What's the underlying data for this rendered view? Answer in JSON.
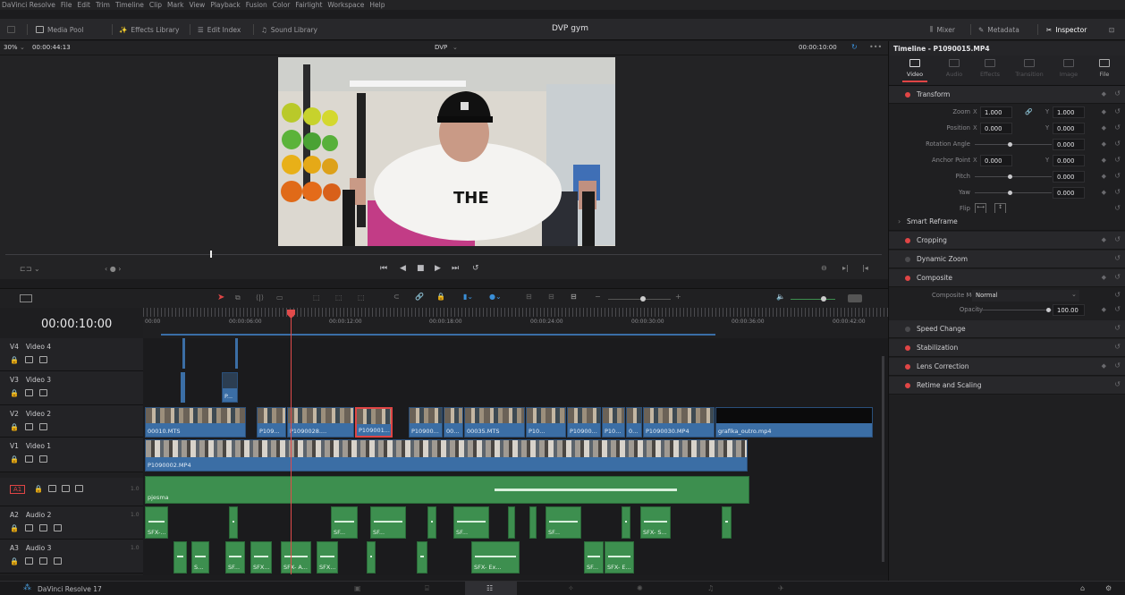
{
  "app": {
    "menu": [
      "DaVinci Resolve",
      "File",
      "Edit",
      "Trim",
      "Timeline",
      "Clip",
      "Mark",
      "View",
      "Playback",
      "Fusion",
      "Color",
      "Fairlight",
      "Workspace",
      "Help"
    ],
    "project_title": "DVP gym",
    "version_label": "DaVinci Resolve 17"
  },
  "toolbar": {
    "media_pool": "Media Pool",
    "effects_library": "Effects Library",
    "edit_index": "Edit Index",
    "sound_library": "Sound Library",
    "mixer": "Mixer",
    "metadata": "Metadata",
    "inspector": "Inspector"
  },
  "viewer": {
    "zoom": "30%",
    "source_tc": "00:00:44:13",
    "timeline_name": "DVP",
    "program_tc": "00:00:10:00",
    "dots": "•••"
  },
  "timeline": {
    "current_tc": "00:00:10:00",
    "ruler": [
      "00:00",
      "00:00:06:00",
      "00:00:12:00",
      "00:00:18:00",
      "00:00:24:00",
      "00:00:30:00",
      "00:00:36:00",
      "00:00:42:00"
    ],
    "tracks": [
      {
        "id": "V4",
        "name": "Video 4"
      },
      {
        "id": "V3",
        "name": "Video 3"
      },
      {
        "id": "V2",
        "name": "Video 2"
      },
      {
        "id": "V1",
        "name": "Video 1"
      },
      {
        "id": "A1",
        "name": "",
        "level": "1.0"
      },
      {
        "id": "A2",
        "name": "Audio 2",
        "level": "1.0"
      },
      {
        "id": "A3",
        "name": "Audio 3",
        "level": "1.0"
      }
    ],
    "v3_clip": "P...",
    "v2_labels": [
      "00010.MTS",
      "P109...",
      "P1090028....",
      "P109001...",
      "P10900...",
      "00...",
      "00035.MTS",
      "P10...",
      "P10900...",
      "P10...",
      "0...",
      "P1090030.MP4",
      "grafika_outro.mp4"
    ],
    "v1_label": "P1090002.MP4",
    "a1_label": "pjesma",
    "a2_labels": [
      "SFX-...",
      "SF...",
      "SF...",
      "SF...",
      "SF...",
      "SFX- S..."
    ],
    "a3_labels": [
      "S...",
      "SF...",
      "SFX...",
      "SFX- A...",
      "SFX...",
      "SFX- Ex...",
      "SF...",
      "SFX- E..."
    ]
  },
  "inspector": {
    "title": "Timeline - P1090015.MP4",
    "tabs": [
      "Video",
      "Audio",
      "Effects",
      "Transition",
      "Image",
      "File"
    ],
    "transform": "Transform",
    "zoom_label": "Zoom",
    "zoom_x": "1.000",
    "zoom_y": "1.000",
    "position_label": "Position",
    "pos_x": "0.000",
    "pos_y": "0.000",
    "rotation_label": "Rotation Angle",
    "rotation": "0.000",
    "anchor_label": "Anchor Point",
    "anchor_x": "0.000",
    "anchor_y": "0.000",
    "pitch_label": "Pitch",
    "pitch": "0.000",
    "yaw_label": "Yaw",
    "yaw": "0.000",
    "flip_label": "Flip",
    "smart_reframe": "Smart Reframe",
    "cropping": "Cropping",
    "dynamic_zoom": "Dynamic Zoom",
    "composite": "Composite",
    "composite_mode_label": "Composite Mode",
    "composite_mode": "Normal",
    "opacity_label": "Opacity",
    "opacity": "100.00",
    "speed_change": "Speed Change",
    "stabilization": "Stabilization",
    "lens_correction": "Lens Correction",
    "retime": "Retime and Scaling",
    "x": "X",
    "y": "Y"
  },
  "colors": {
    "accent": "#e04545",
    "video_clip": "#3b6ea5",
    "audio_clip": "#3d8f4f",
    "playhead": "#e14b4b"
  }
}
